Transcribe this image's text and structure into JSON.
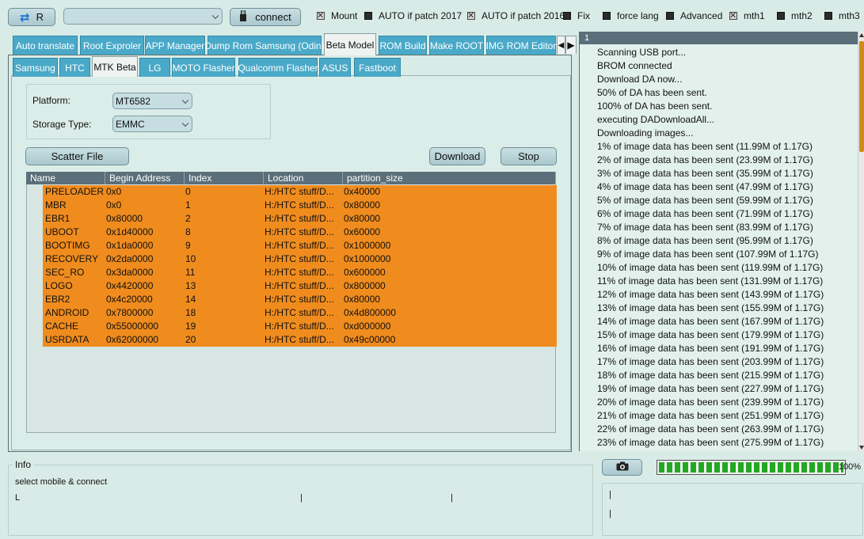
{
  "toolbar": {
    "refresh_label": "R",
    "port_combo_value": "",
    "connect_label": "connect",
    "checkboxes": [
      {
        "label": "Mount",
        "checked": true
      },
      {
        "label": "AUTO if patch 2017",
        "checked": false
      },
      {
        "label": "AUTO if patch 2016",
        "checked": true
      },
      {
        "label": "Fix",
        "checked": false
      },
      {
        "label": "force lang",
        "checked": false
      },
      {
        "label": "Advanced",
        "checked": false
      },
      {
        "label": "mth1",
        "checked": true
      },
      {
        "label": "mth2",
        "checked": false
      },
      {
        "label": "mth3",
        "checked": false
      }
    ]
  },
  "main_tabs": [
    "Auto translate",
    "Root Exproler",
    "APP Manager",
    "Dump Rom Samsung (Odin)",
    "Beta Model",
    "ROM Build",
    "Make ROOT",
    "IMG ROM Editor"
  ],
  "active_main_tab": "Beta Model",
  "sub_tabs": [
    "Samsung",
    "HTC",
    "MTK Beta",
    "LG",
    "MOTO Flasher",
    "Qualcomm Flasher",
    "ASUS",
    "Fastboot"
  ],
  "active_sub_tab": "MTK Beta",
  "settings": {
    "platform_label": "Platform:",
    "platform_value": "MT6582",
    "storage_label": "Storage Type:",
    "storage_value": "EMMC"
  },
  "actions": {
    "scatter_label": "Scatter File",
    "download_label": "Download",
    "stop_label": "Stop"
  },
  "partition_table": {
    "columns": [
      "Name",
      "Begin Address",
      "Index",
      "Location",
      "partition_size"
    ],
    "rows": [
      [
        "PRELOADER",
        "0x0",
        "0",
        "H:/HTC stuff/D...",
        "0x40000"
      ],
      [
        "MBR",
        "0x0",
        "1",
        "H:/HTC stuff/D...",
        "0x80000"
      ],
      [
        "EBR1",
        "0x80000",
        "2",
        "H:/HTC stuff/D...",
        "0x80000"
      ],
      [
        "UBOOT",
        "0x1d40000",
        "8",
        "H:/HTC stuff/D...",
        "0x60000"
      ],
      [
        "BOOTIMG",
        "0x1da0000",
        "9",
        "H:/HTC stuff/D...",
        "0x1000000"
      ],
      [
        "RECOVERY",
        "0x2da0000",
        "10",
        "H:/HTC stuff/D...",
        "0x1000000"
      ],
      [
        "SEC_RO",
        "0x3da0000",
        "11",
        "H:/HTC stuff/D...",
        "0x600000"
      ],
      [
        "LOGO",
        "0x4420000",
        "13",
        "H:/HTC stuff/D...",
        "0x800000"
      ],
      [
        "EBR2",
        "0x4c20000",
        "14",
        "H:/HTC stuff/D...",
        "0x80000"
      ],
      [
        "ANDROID",
        "0x7800000",
        "18",
        "H:/HTC stuff/D...",
        "0x4d800000"
      ],
      [
        "CACHE",
        "0x55000000",
        "19",
        "H:/HTC stuff/D...",
        "0xd000000"
      ],
      [
        "USRDATA",
        "0x62000000",
        "20",
        "H:/HTC stuff/D...",
        "0x49c00000"
      ]
    ]
  },
  "log": {
    "header": "1",
    "lines": [
      "Scanning USB port...",
      "BROM connected",
      "Download DA now...",
      "50% of DA has been sent.",
      "100% of DA has been sent.",
      "executing DADownloadAll...",
      "Downloading images...",
      "1% of image data has been sent (11.99M of 1.17G)",
      "2% of image data has been sent (23.99M of 1.17G)",
      "3% of image data has been sent (35.99M of 1.17G)",
      "4% of image data has been sent (47.99M of 1.17G)",
      "5% of image data has been sent (59.99M of 1.17G)",
      "6% of image data has been sent (71.99M of 1.17G)",
      "7% of image data has been sent (83.99M of 1.17G)",
      "8% of image data has been sent (95.99M of 1.17G)",
      "9% of image data has been sent (107.99M of 1.17G)",
      "10% of image data has been sent (119.99M of 1.17G)",
      "11% of image data has been sent (131.99M of 1.17G)",
      "12% of image data has been sent (143.99M of 1.17G)",
      "13% of image data has been sent (155.99M of 1.17G)",
      "14% of image data has been sent (167.99M of 1.17G)",
      "15% of image data has been sent (179.99M of 1.17G)",
      "16% of image data has been sent (191.99M of 1.17G)",
      "17% of image data has been sent (203.99M of 1.17G)",
      "18% of image data has been sent (215.99M of 1.17G)",
      "19% of image data has been sent (227.99M of 1.17G)",
      "20% of image data has been sent (239.99M of 1.17G)",
      "21% of image data has been sent (251.99M of 1.17G)",
      "22% of image data has been sent (263.99M of 1.17G)",
      "23% of image data has been sent (275.99M of 1.17G)"
    ]
  },
  "info": {
    "title": "Info",
    "message": "select mobile & connect",
    "status_left": "L",
    "status_mid1": "|",
    "status_mid2": "|",
    "right_line1": "|",
    "right_line2": "|"
  },
  "progress": {
    "value": 100,
    "label": "100%"
  },
  "colors": {
    "background": "#d9ebe6",
    "tab": "#4aa9c8",
    "row_highlight": "#f08c1e",
    "grid_header": "#5a6f7a",
    "progress": "#22a822"
  },
  "icons": {
    "refresh": "refresh-icon",
    "usb": "usb-icon",
    "camera": "camera-icon"
  }
}
